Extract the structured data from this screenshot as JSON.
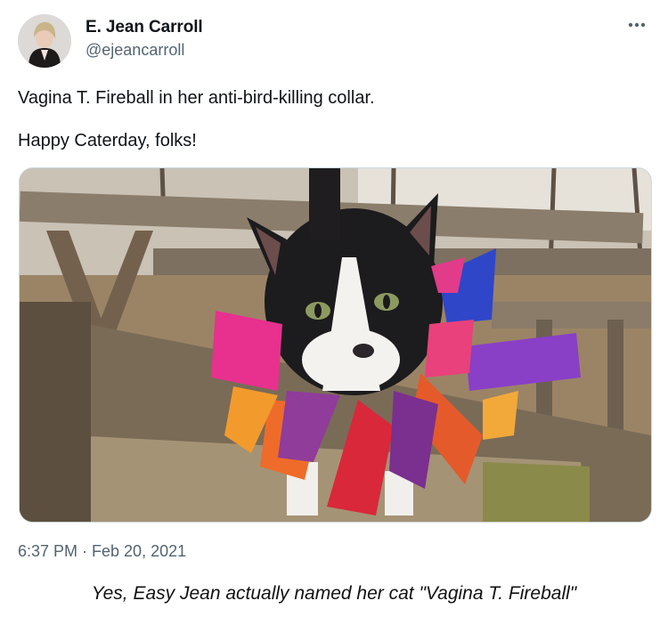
{
  "tweet": {
    "author": {
      "display_name": "E. Jean Carroll",
      "handle": "@ejeancarroll",
      "avatar_icon": "profile-photo"
    },
    "more_icon": "more-options-icon",
    "text_lines": [
      "Vagina T. Fireball in her anti-bird-killing collar.",
      "Happy Caterday, folks!"
    ],
    "media": {
      "kind": "photo",
      "subject": "tuxedo-cat-in-ribbon-collar"
    },
    "timestamp": "6:37 PM · Feb 20, 2021"
  },
  "caption": "Yes, Easy Jean actually named her cat \"Vagina T. Fireball\""
}
